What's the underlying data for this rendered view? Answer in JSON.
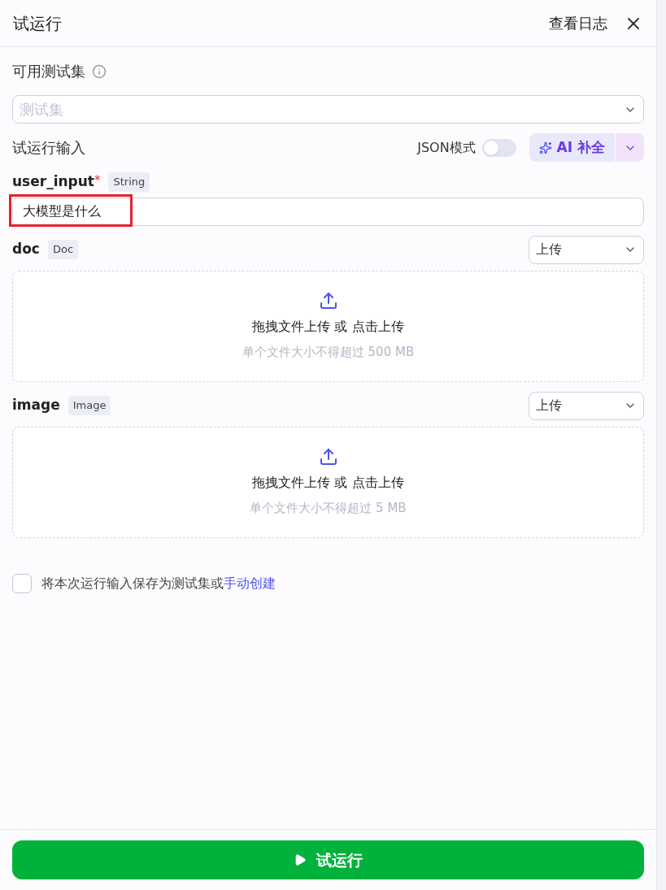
{
  "header": {
    "title": "试运行",
    "log_link": "查看日志"
  },
  "test_set": {
    "label": "可用测试集",
    "placeholder": "测试集"
  },
  "run_input": {
    "label": "试运行输入",
    "json_mode_label": "JSON模式",
    "json_mode_on": false,
    "ai_button": "AI 补全"
  },
  "fields": [
    {
      "kind": "text",
      "name": "user_input",
      "required_mark": "*",
      "type": "String",
      "value": "大模型是什么",
      "highlighted": true
    },
    {
      "kind": "file",
      "name": "doc",
      "type": "Doc",
      "mode": "上传",
      "prompt": "拖拽文件上传 或 点击上传",
      "hint": "单个文件大小不得超过 500 MB"
    },
    {
      "kind": "file",
      "name": "image",
      "type": "Image",
      "mode": "上传",
      "prompt": "拖拽文件上传 或 点击上传",
      "hint": "单个文件大小不得超过 5 MB"
    }
  ],
  "save_option": {
    "checked": false,
    "text": "将本次运行输入保存为测试集或",
    "link": "手动创建"
  },
  "run_button": "试运行"
}
